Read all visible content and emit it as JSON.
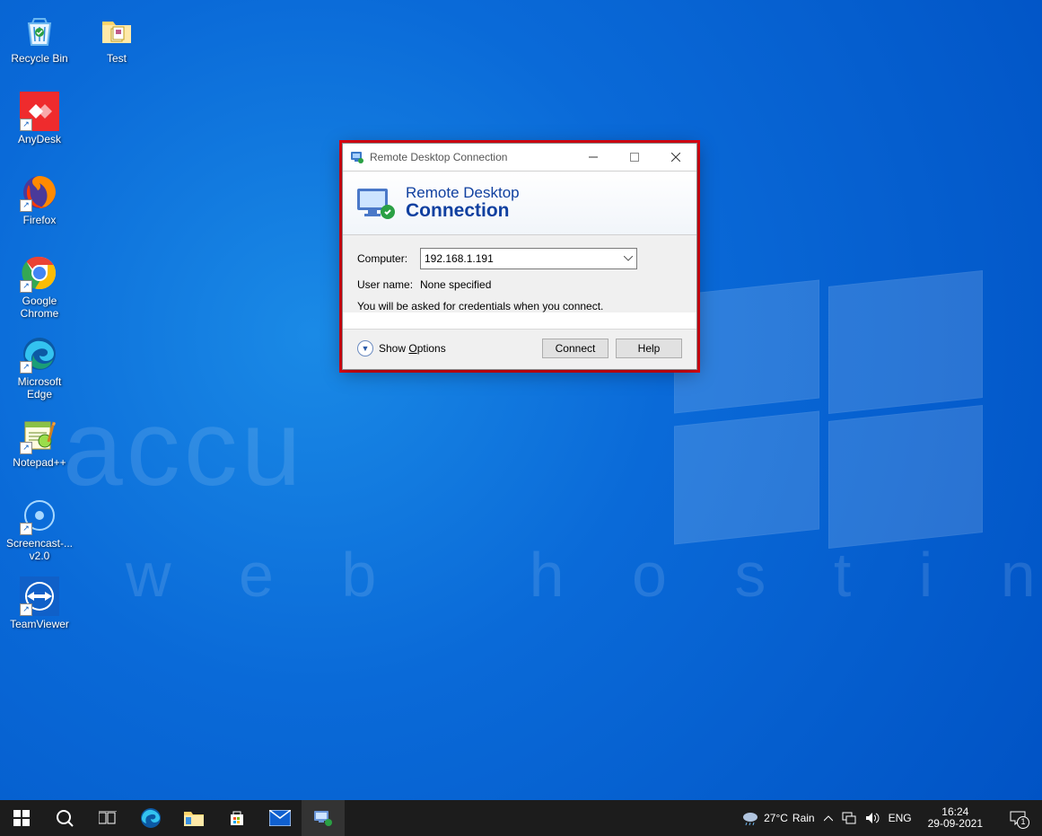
{
  "desktop_icons_col1": [
    {
      "label": "Recycle Bin",
      "icon": "recycle-bin",
      "shortcut": false
    },
    {
      "label": "AnyDesk",
      "icon": "anydesk",
      "shortcut": true
    },
    {
      "label": "Firefox",
      "icon": "firefox",
      "shortcut": true
    },
    {
      "label": "Google Chrome",
      "icon": "chrome",
      "shortcut": true
    },
    {
      "label": "Microsoft Edge",
      "icon": "edge",
      "shortcut": true
    },
    {
      "label": "Notepad++",
      "icon": "notepadpp",
      "shortcut": true
    },
    {
      "label": "Screencast-... v2.0",
      "icon": "screencast",
      "shortcut": true
    },
    {
      "label": "TeamViewer",
      "icon": "teamviewer",
      "shortcut": true
    }
  ],
  "desktop_icons_col2": [
    {
      "label": "Test",
      "icon": "folder",
      "shortcut": false
    }
  ],
  "window": {
    "title": "Remote Desktop Connection",
    "banner_line1": "Remote Desktop",
    "banner_line2": "Connection",
    "computer_label": "Computer:",
    "computer_value": "192.168.1.191",
    "username_label": "User name:",
    "username_value": "None specified",
    "hint": "You will be asked for credentials when you connect.",
    "show_options": "Show Options",
    "connect": "Connect",
    "help": "Help"
  },
  "taskbar": {
    "weather_temp": "27°C",
    "weather_cond": "Rain",
    "lang": "ENG",
    "time": "16:24",
    "date": "29-09-2021",
    "notif_count": "1"
  },
  "watermark_top": "accu",
  "watermark_bottom": "w e b   h o s t i n g"
}
